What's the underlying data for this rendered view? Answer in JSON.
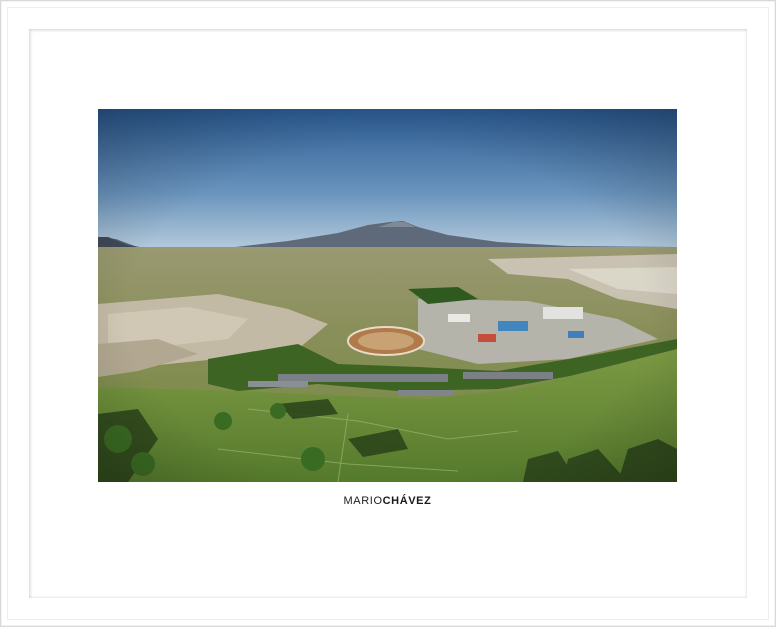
{
  "caption": {
    "first_name": "MARIO",
    "last_name": "CHÁVEZ"
  },
  "photo": {
    "subject": "aerial-landscape",
    "colors": {
      "sky_top": "#2f5f96",
      "sky_horizon": "#a9c3d8",
      "mountain": "#5c6775",
      "field": "#6f8f3c",
      "field_dark": "#3f5c22"
    }
  }
}
